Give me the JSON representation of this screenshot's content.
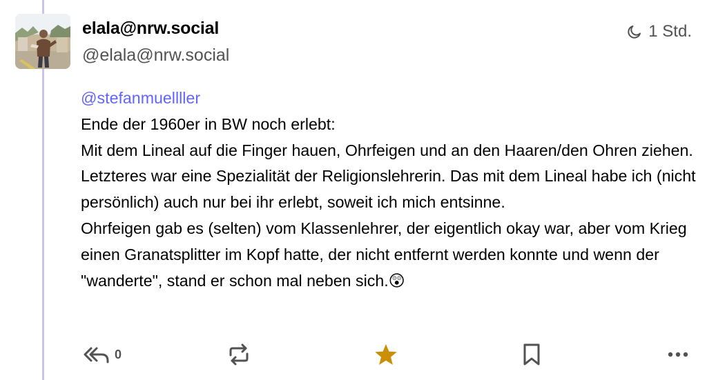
{
  "status": {
    "author": {
      "display_name": "elala@nrw.social",
      "acct": "@elala@nrw.social",
      "avatar_icon": "avatar-photo"
    },
    "timestamp": "1 Std.",
    "mention": "@stefanmuellller",
    "paragraphs": [
      "Ende der 1960er in BW noch erlebt:",
      "Mit dem Lineal auf die Finger hauen, Ohrfeigen und an den Haaren/den Ohren ziehen. Letzteres war eine Spezialität der Religionslehrerin. Das mit dem Lineal habe ich (nicht persönlich) auch nur bei ihr erlebt, soweit ich mich entsinne.",
      "Ohrfeigen gab es (selten) vom Klassenlehrer, der eigentlich okay war, aber vom Krieg einen Granatsplitter im Kopf hatte, der nicht entfernt werden konnte und wenn der \"wanderte\", stand er schon mal neben sich.😲"
    ],
    "actions": {
      "reply_count": "0",
      "reply_icon": "reply-all-icon",
      "boost_icon": "boost-icon",
      "favourite_icon": "star-icon",
      "bookmark_icon": "bookmark-icon",
      "more_icon": "more-icon"
    }
  },
  "colors": {
    "accent": "#6364ff",
    "thread_line": "#c9c4e9",
    "favourite": "#ca8f04",
    "secondary_text": "#525252"
  }
}
